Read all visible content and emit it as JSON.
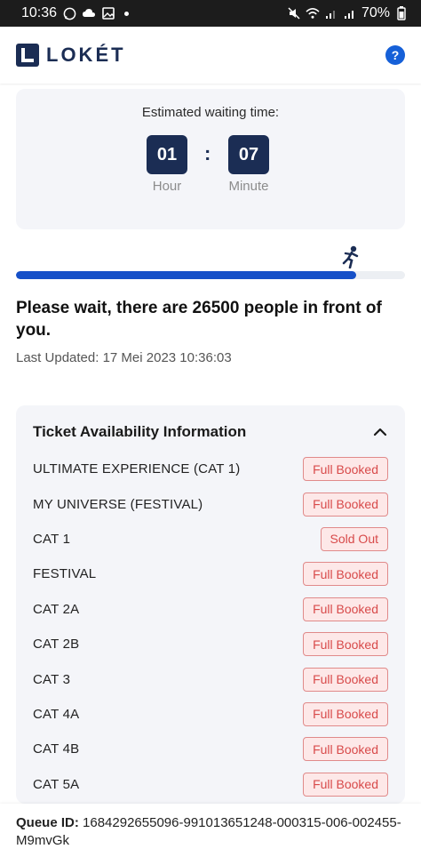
{
  "status_bar": {
    "time": "10:36",
    "battery": "70%",
    "left_icons": [
      "whatsapp-icon",
      "cloud-icon",
      "image-icon"
    ],
    "right_icons": [
      "mute-icon",
      "wifi-icon",
      "signal-icon",
      "signal-icon",
      "battery-icon"
    ]
  },
  "app": {
    "brand": "LOKÉT",
    "help_icon": "question-icon",
    "help_label": "?"
  },
  "waiting": {
    "title": "Estimated waiting time:",
    "hour": "01",
    "minute": "07",
    "separator": ":",
    "hour_label": "Hour",
    "minute_label": "Minute"
  },
  "queue_progress": {
    "fraction": 0.875,
    "color": "#1650c8",
    "icon": "runner-icon"
  },
  "message": "Please wait, there are 26500 people in front of you.",
  "last_updated": "Last Updated: 17 Mei 2023 10:36:03",
  "tickets": {
    "title": "Ticket Availability Information",
    "toggle_icon": "chevron-up-icon",
    "items": [
      {
        "name": "ULTIMATE EXPERIENCE (CAT 1)",
        "status": "Full Booked"
      },
      {
        "name": "MY UNIVERSE (FESTIVAL)",
        "status": "Full Booked"
      },
      {
        "name": "CAT 1",
        "status": "Sold Out"
      },
      {
        "name": "FESTIVAL",
        "status": "Full Booked"
      },
      {
        "name": "CAT 2A",
        "status": "Full Booked"
      },
      {
        "name": "CAT 2B",
        "status": "Full Booked"
      },
      {
        "name": "CAT 3",
        "status": "Full Booked"
      },
      {
        "name": "CAT 4A",
        "status": "Full Booked"
      },
      {
        "name": "CAT 4B",
        "status": "Full Booked"
      },
      {
        "name": "CAT 5A",
        "status": "Full Booked"
      }
    ]
  },
  "queue": {
    "label": "Queue ID",
    "colon": ":",
    "id": "1684292655096-991013651248-000315-006-002455-M9mvGk"
  },
  "colors": {
    "brand_navy": "#1b2d54",
    "accent_blue": "#1660d8",
    "badge_red": "#d84a4a"
  }
}
